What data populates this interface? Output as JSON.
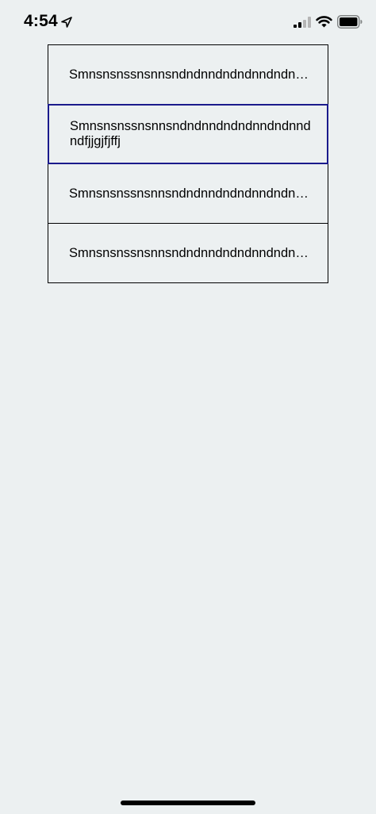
{
  "status_bar": {
    "time": "4:54",
    "icons": [
      "location-arrow-icon",
      "cellular-signal-icon",
      "wifi-icon",
      "battery-icon"
    ]
  },
  "list": {
    "items": [
      {
        "text": "Smnsnsnssnsnnsndndnndndndnndndnndndfjjgjfjffj",
        "selected": false
      },
      {
        "text": "Smnsnsnssnsnnsndndnndndndnndndnndndfjjgjfjffj",
        "selected": true
      },
      {
        "text": "Smnsnsnssnsnnsndndnndndndnndndnndndfjjgjfjffj",
        "selected": false
      },
      {
        "text": "Smnsnsnssnsnnsndndnndndndnndndnndndfjjgjfjffj",
        "selected": false
      }
    ]
  },
  "colors": {
    "background": "#ecf0f1",
    "cell_border": "#000000",
    "selected_border": "#1a1a8c"
  }
}
